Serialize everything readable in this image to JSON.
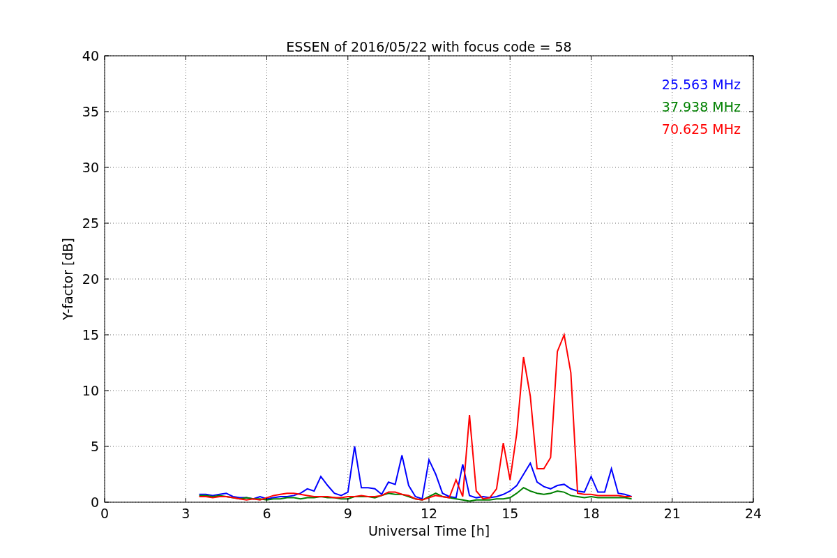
{
  "figure": {
    "chart_data": {
      "type": "line",
      "title": "ESSEN of 2016/05/22 with focus code = 58",
      "xlabel": "Universal Time [h]",
      "ylabel": "Y-factor [dB]",
      "x": [
        3.5,
        3.75,
        4,
        4.25,
        4.5,
        4.75,
        5,
        5.25,
        5.5,
        5.75,
        6,
        6.25,
        6.5,
        6.75,
        7,
        7.25,
        7.5,
        7.75,
        8,
        8.25,
        8.5,
        8.75,
        9,
        9.25,
        9.5,
        9.75,
        10,
        10.25,
        10.5,
        10.75,
        11,
        11.25,
        11.5,
        11.75,
        12,
        12.25,
        12.5,
        12.75,
        13,
        13.25,
        13.5,
        13.75,
        14,
        14.25,
        14.5,
        14.75,
        15,
        15.25,
        15.5,
        15.75,
        16,
        16.25,
        16.5,
        16.75,
        17,
        17.25,
        17.5,
        17.75,
        18,
        18.25,
        18.5,
        18.75,
        19,
        19.25,
        19.5
      ],
      "series": [
        {
          "name": "25.563 MHz",
          "color": "#0000ff",
          "values": [
            0.7,
            0.7,
            0.6,
            0.7,
            0.8,
            0.5,
            0.4,
            0.4,
            0.3,
            0.5,
            0.3,
            0.4,
            0.5,
            0.5,
            0.6,
            0.8,
            1.2,
            1.0,
            2.3,
            1.5,
            0.8,
            0.6,
            0.9,
            5.0,
            1.3,
            1.3,
            1.2,
            0.7,
            1.8,
            1.6,
            4.2,
            1.5,
            0.5,
            0.3,
            3.8,
            2.5,
            0.8,
            0.5,
            0.4,
            3.4,
            0.6,
            0.4,
            0.5,
            0.4,
            0.5,
            0.7,
            1.0,
            1.5,
            2.5,
            3.5,
            1.8,
            1.4,
            1.2,
            1.5,
            1.6,
            1.2,
            1.0,
            0.9,
            2.3,
            0.9,
            0.9,
            3.0,
            0.8,
            0.7,
            0.5
          ]
        },
        {
          "name": "37.938 MHz",
          "color": "#008000",
          "values": [
            0.6,
            0.6,
            0.5,
            0.6,
            0.5,
            0.4,
            0.3,
            0.4,
            0.3,
            0.3,
            0.2,
            0.3,
            0.3,
            0.4,
            0.4,
            0.3,
            0.4,
            0.4,
            0.5,
            0.4,
            0.4,
            0.3,
            0.3,
            0.5,
            0.5,
            0.5,
            0.4,
            0.6,
            0.8,
            0.7,
            0.7,
            0.5,
            0.3,
            0.2,
            0.5,
            0.8,
            0.5,
            0.4,
            0.3,
            0.2,
            0.1,
            0.2,
            0.2,
            0.2,
            0.3,
            0.3,
            0.4,
            0.8,
            1.3,
            1.0,
            0.8,
            0.7,
            0.8,
            1.0,
            0.9,
            0.6,
            0.5,
            0.4,
            0.5,
            0.4,
            0.4,
            0.4,
            0.4,
            0.4,
            0.3
          ]
        },
        {
          "name": "70.625 MHz",
          "color": "#ff0000",
          "values": [
            0.5,
            0.5,
            0.4,
            0.5,
            0.5,
            0.4,
            0.3,
            0.2,
            0.3,
            0.2,
            0.4,
            0.6,
            0.7,
            0.8,
            0.8,
            0.7,
            0.6,
            0.5,
            0.5,
            0.5,
            0.4,
            0.4,
            0.5,
            0.5,
            0.6,
            0.5,
            0.5,
            0.6,
            0.9,
            0.9,
            0.7,
            0.6,
            0.3,
            0.2,
            0.4,
            0.6,
            0.5,
            0.4,
            2.0,
            0.5,
            7.8,
            1.0,
            0.3,
            0.4,
            1.2,
            5.3,
            2.0,
            6.2,
            13.0,
            9.5,
            3.0,
            3.0,
            4.0,
            13.5,
            15.0,
            11.6,
            0.8,
            0.7,
            0.7,
            0.6,
            0.6,
            0.6,
            0.6,
            0.5,
            0.5
          ]
        }
      ],
      "grid": true,
      "xlim": [
        0,
        24
      ],
      "ylim": [
        0,
        40
      ],
      "xticks": [
        0,
        3,
        6,
        9,
        12,
        15,
        18,
        21,
        24
      ],
      "yticks": [
        0,
        5,
        10,
        15,
        20,
        25,
        30,
        35,
        40
      ]
    }
  }
}
